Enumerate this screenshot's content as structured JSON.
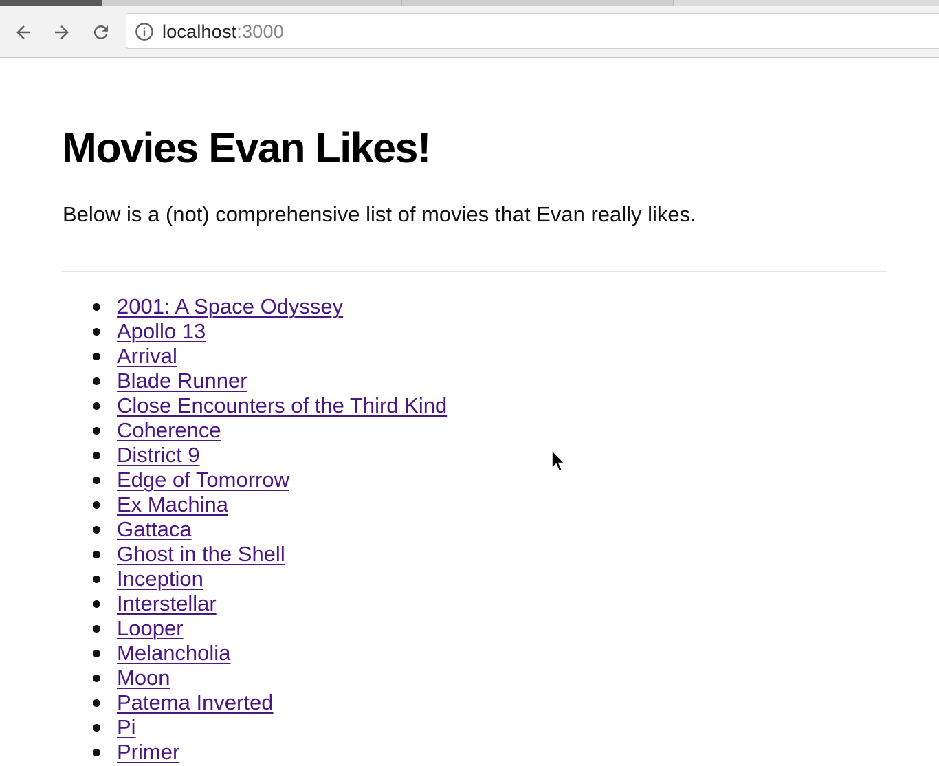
{
  "browser": {
    "url_host": "localhost",
    "url_port": ":3000",
    "icons": {
      "back": "back-arrow-icon",
      "forward": "forward-arrow-icon",
      "reload": "reload-icon",
      "site_info": "info-icon"
    }
  },
  "page": {
    "title": "Movies Evan Likes!",
    "intro": "Below is a (not) comprehensive list of movies that Evan really likes.",
    "movies": [
      "2001: A Space Odyssey",
      "Apollo 13",
      "Arrival",
      "Blade Runner",
      "Close Encounters of the Third Kind",
      "Coherence",
      "District 9",
      "Edge of Tomorrow",
      "Ex Machina",
      "Gattaca",
      "Ghost in the Shell",
      "Inception",
      "Interstellar",
      "Looper",
      "Melancholia",
      "Moon",
      "Patema Inverted",
      "Pi",
      "Primer"
    ]
  },
  "colors": {
    "visited_link": "#4b1882",
    "text": "#000000",
    "divider": "#e2e2e2",
    "toolbar": "#f2f2f2"
  }
}
